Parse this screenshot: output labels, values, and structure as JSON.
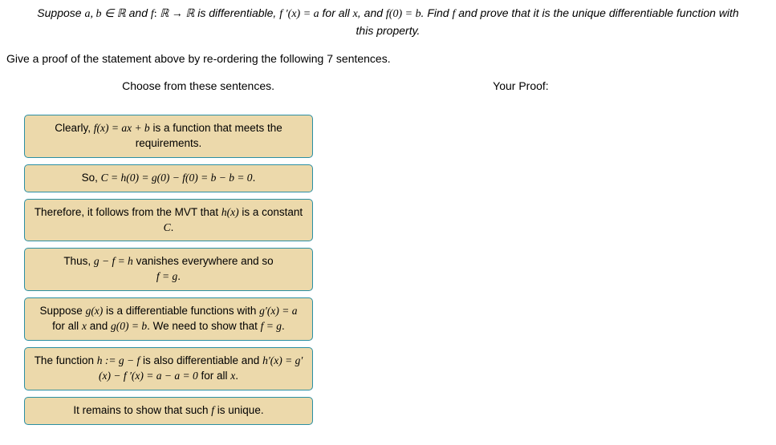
{
  "problem": {
    "line1_pre": "Suppose ",
    "line1_ab": "a, b ∈ ",
    "line1_R": "ℝ",
    "line1_and": " and ",
    "line1_f": "f",
    "line1_colon": ": ",
    "line1_R2": "ℝ → ℝ",
    "line1_diff": " is differentiable, ",
    "line1_fp": "f ′(x) = a",
    "line1_forall": " for all ",
    "line1_x": "x",
    "line1_andf0": ", and ",
    "line1_f0": "f(0) = b",
    "line1_find": ". Find ",
    "line1_f2": "f",
    "line1_rest": " and prove that it is the unique differentiable function with",
    "line2": "this property."
  },
  "instruction": "Give a proof of the statement above by re-ordering the following 7 sentences.",
  "headers": {
    "left": "Choose from these sentences.",
    "right": "Your Proof:"
  },
  "cards": {
    "c1": {
      "pre": "Clearly, ",
      "math": "f(x) = ax + b",
      "post": " is a function that meets the requirements."
    },
    "c2": {
      "pre": "So, ",
      "math": "C = h(0) = g(0) − f(0) = b − b = 0",
      "post": "."
    },
    "c3": {
      "pre": "Therefore, it follows from the MVT that ",
      "math1": "h(x)",
      "mid": " is a constant ",
      "math2": "C",
      "post": "."
    },
    "c4": {
      "pre": "Thus, ",
      "math1": "g − f = h",
      "mid": " vanishes everywhere and so ",
      "math2": "f = g",
      "post": "."
    },
    "c5": {
      "pre": "Suppose ",
      "math1": "g(x)",
      "mid1": " is a differentiable functions with ",
      "math2": "g′(x) = a",
      "mid2": " for all ",
      "math3": "x",
      "mid3": " and ",
      "math4": "g(0) = b",
      "mid4": ". We need to show that ",
      "math5": "f = g",
      "post": "."
    },
    "c6": {
      "pre": "The function ",
      "math1": "h := g − f",
      "mid1": " is also differentiable and ",
      "math2": "h′(x) = g′(x) − f ′(x) = a − a = 0",
      "mid2": " for all ",
      "math3": "x",
      "post": "."
    },
    "c7": {
      "pre": "It remains to show that such ",
      "math": "f",
      "post": " is unique."
    }
  }
}
